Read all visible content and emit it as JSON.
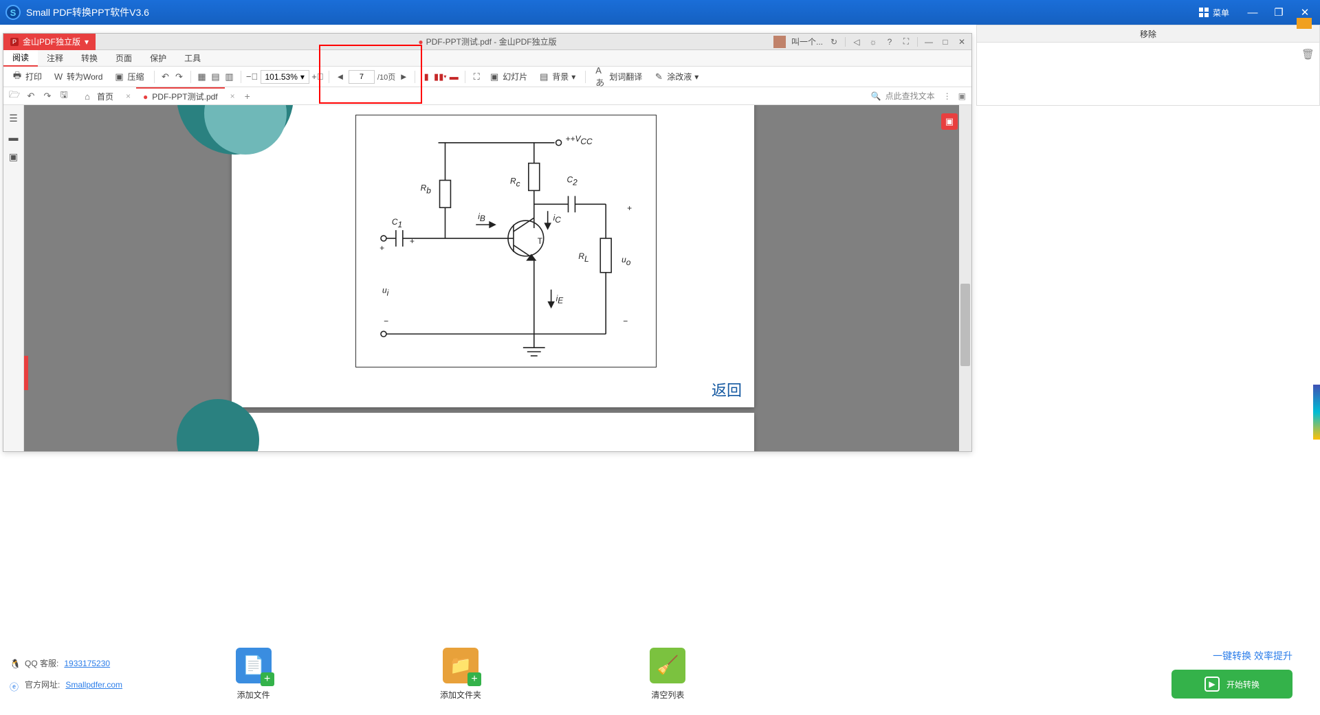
{
  "outer": {
    "title": "Small PDF转换PPT软件V3.6",
    "menu": "菜单"
  },
  "pdfwin": {
    "apptab": "金山PDF独立版",
    "doctitle": "PDF-PPT测试.pdf - 金山PDF独立版",
    "username": "叫一个...",
    "menus": [
      "阅读",
      "注释",
      "转换",
      "页面",
      "保护",
      "工具"
    ],
    "active_menu": 0,
    "toolbar": {
      "print": "打印",
      "toword": "转为Word",
      "compress": "压缩",
      "zoom": "101.53%",
      "page_current": "7",
      "page_total": "/10页",
      "slide": "幻灯片",
      "bg": "背景",
      "translate": "划词翻译",
      "redact": "涂改液"
    },
    "hometab": "首页",
    "doctab": "PDF-PPT测试.pdf",
    "search_placeholder": "点此查找文本",
    "circuit": {
      "vcc": "+V",
      "vcc2": "CC",
      "rb": "R",
      "rb2": "b",
      "rc": "R",
      "rc2": "c",
      "c1": "C",
      "c12": "1",
      "c2": "C",
      "c22": "2",
      "ib": "i",
      "ib2": "B",
      "ic": "i",
      "ic2": "C",
      "ie": "i",
      "ie2": "E",
      "rl": "R",
      "rl2": "L",
      "uo": "u",
      "uo2": "o",
      "ui": "u",
      "ui2": "i",
      "t": "T"
    },
    "back": "返回"
  },
  "rightcol": {
    "header": "移除"
  },
  "bottom": {
    "qq_label": "QQ 客服:",
    "qq": "1933175230",
    "site_label": "官方网址:",
    "site": "Smallpdfer.com",
    "add_file": "添加文件",
    "add_folder": "添加文件夹",
    "clear": "清空列表",
    "slogan": "一键转换 效率提升",
    "start": "开始转换"
  }
}
